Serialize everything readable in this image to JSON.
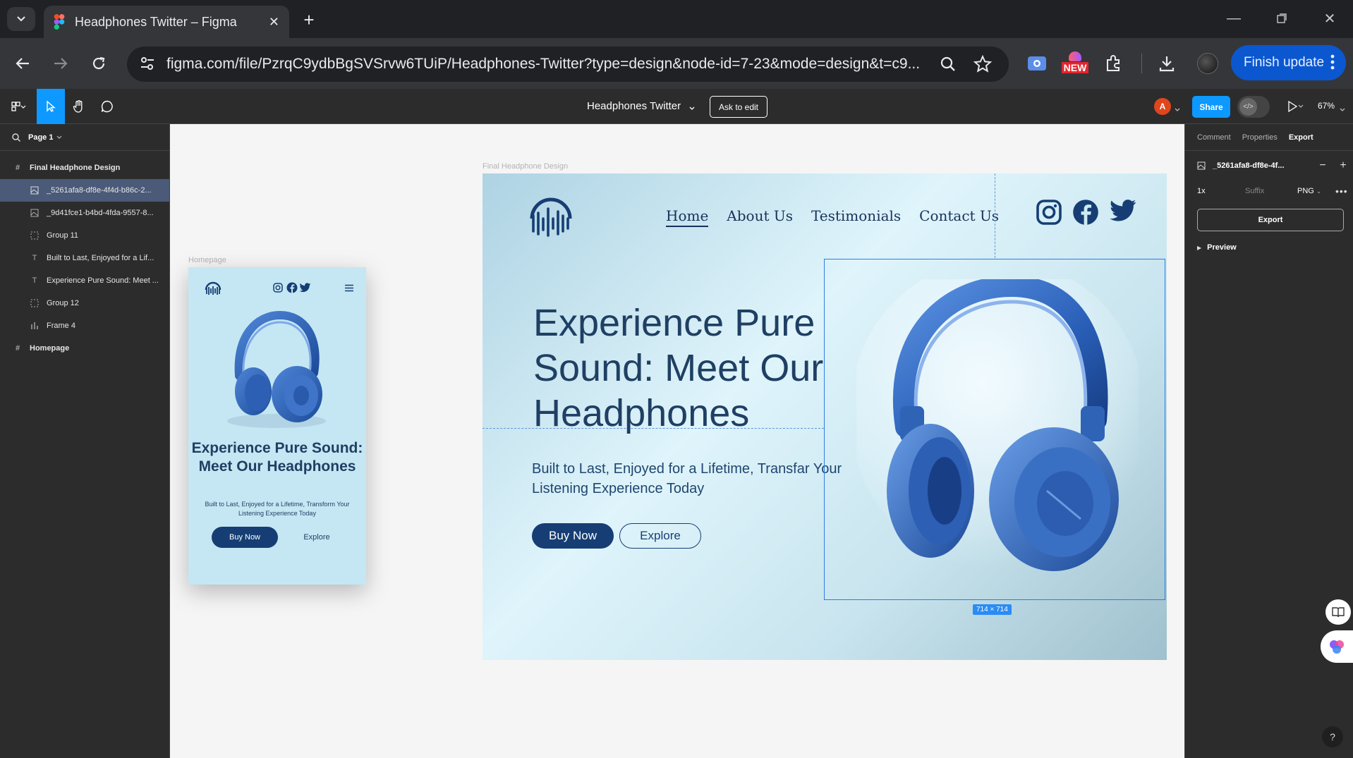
{
  "browser": {
    "tab_title": "Headphones Twitter – Figma",
    "url": "figma.com/file/PzrqC9ydbBgSVSrvw6TUiP/Headphones-Twitter?type=design&node-id=7-23&mode=design&t=c9...",
    "new_badge": "NEW",
    "finish_update": "Finish update"
  },
  "figma": {
    "file_title": "Headphones Twitter",
    "ask_to_edit": "Ask to edit",
    "avatar_initial": "A",
    "share": "Share",
    "zoom": "67%"
  },
  "layers": {
    "page": "Page 1",
    "items": [
      {
        "label": "Final Headphone Design",
        "type": "frame",
        "level": "top"
      },
      {
        "label": "_5261afa8-df8e-4f4d-b86c-2...",
        "type": "image",
        "level": "child",
        "selected": true
      },
      {
        "label": "_9d41fce1-b4bd-4fda-9557-8...",
        "type": "image",
        "level": "child"
      },
      {
        "label": "Group 11",
        "type": "group",
        "level": "child"
      },
      {
        "label": "Built to Last, Enjoyed for a Lif...",
        "type": "text",
        "level": "child"
      },
      {
        "label": "Experience Pure Sound: Meet ...",
        "type": "text",
        "level": "child"
      },
      {
        "label": "Group 12",
        "type": "group",
        "level": "child"
      },
      {
        "label": "Frame 4",
        "type": "auto-layout",
        "level": "child"
      },
      {
        "label": "Homepage",
        "type": "frame",
        "level": "top"
      }
    ]
  },
  "canvas": {
    "desktop_label": "Final Headphone Design",
    "mobile_label": "Homepage",
    "selection_size": "714 × 714",
    "desktop": {
      "nav": [
        "Home",
        "About Us",
        "Testimonials",
        "Contact Us"
      ],
      "heading": "Experience Pure Sound: Meet Our Headphones",
      "subheading": "Built to Last, Enjoyed for a Lifetime, Transfar Your Listening Experience Today",
      "buy_now": "Buy Now",
      "explore": "Explore"
    },
    "mobile": {
      "heading": "Experience Pure Sound: Meet Our Headphones",
      "subheading": "Built to Last, Enjoyed for a Lifetime, Transform Your Listening Experience Today",
      "buy_now": "Buy Now",
      "explore": "Explore"
    }
  },
  "right_panel": {
    "tabs": [
      "Comment",
      "Properties",
      "Export"
    ],
    "active_tab": "Export",
    "layer_name": "_5261afa8-df8e-4f...",
    "scale": "1x",
    "suffix_placeholder": "Suffix",
    "format": "PNG",
    "export_button": "Export",
    "preview": "Preview"
  },
  "colors": {
    "figma_accent": "#0d99ff",
    "chrome_update": "#0b57d0",
    "brand_navy": "#163e74",
    "selection_blue": "#2a7fe0"
  }
}
